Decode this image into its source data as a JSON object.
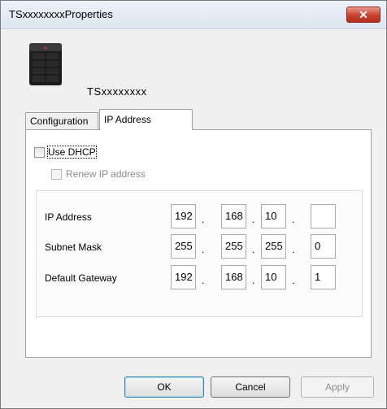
{
  "window": {
    "title": "TSxxxxxxxxProperties",
    "close_glyph": "✕"
  },
  "device": {
    "name": "TSxxxxxxxx",
    "icon": "nas-device-icon"
  },
  "tabs": [
    {
      "label": "Configuration",
      "active": false
    },
    {
      "label": "IP Address",
      "active": true
    }
  ],
  "dhcp": {
    "use_label": "Use DHCP",
    "use_checked": false,
    "renew_label": "Renew IP address",
    "renew_enabled": false
  },
  "fields": [
    {
      "label": "IP Address",
      "octets": [
        "192",
        "168",
        "10",
        ""
      ]
    },
    {
      "label": "Subnet Mask",
      "octets": [
        "255",
        "255",
        "255",
        "0"
      ]
    },
    {
      "label": "Default Gateway",
      "octets": [
        "192",
        "168",
        "10",
        "1"
      ]
    }
  ],
  "separator": ".",
  "buttons": {
    "ok": "OK",
    "cancel": "Cancel",
    "apply": "Apply"
  },
  "colors": {
    "close_button": "#c9402c",
    "ok_border": "#3c7fb1"
  }
}
